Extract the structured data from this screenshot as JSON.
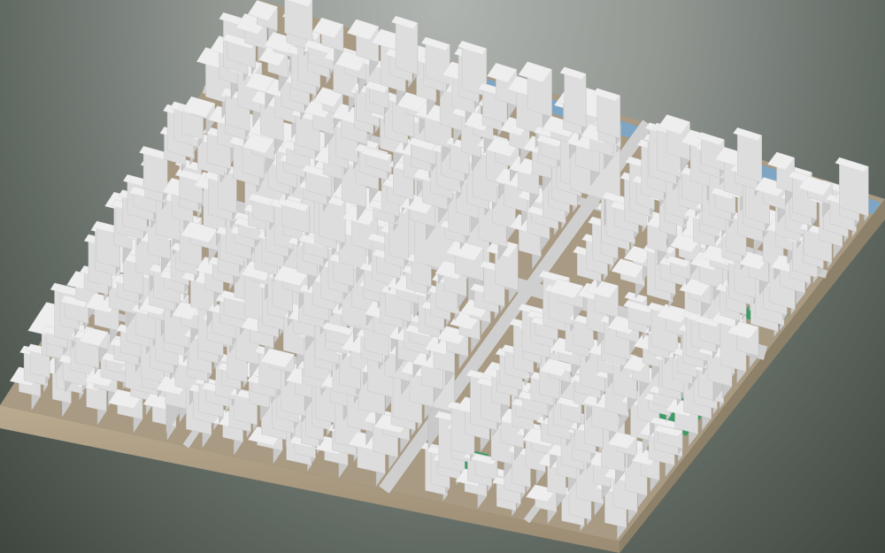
{
  "viewer": {
    "kind": "3d-city-model-view",
    "colors": {
      "background_top": "#b1b5b1",
      "background_bottom": "#3f4640",
      "terrain_top": "#a99a83",
      "terrain_side": "#b6a68c",
      "building_top": "#eeeeee",
      "building_left": "#c9c9c9",
      "building_right": "#dddddd",
      "vegetation": "#3f9a68",
      "water": "#7ea6c4",
      "road": "#cfcfcf"
    }
  }
}
